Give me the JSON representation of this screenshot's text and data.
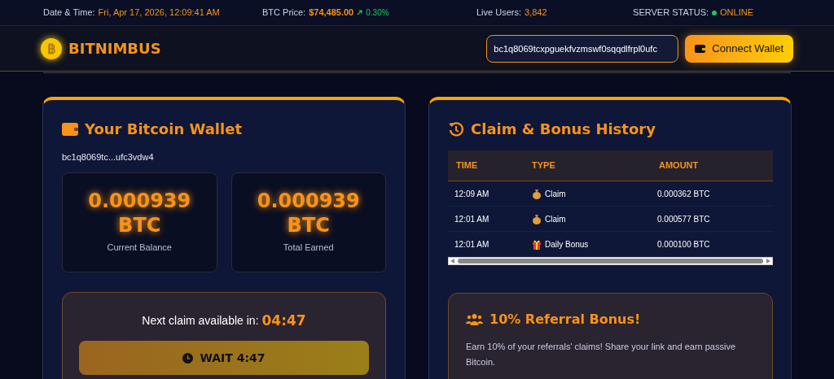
{
  "topbar": {
    "datetime": {
      "label": "Date & Time:",
      "value": "Fri, Apr 17, 2026, 12:09:41 AM"
    },
    "btc_price": {
      "label": "BTC Price:",
      "value": "$74,485.00",
      "change": "0.30%"
    },
    "live_users": {
      "label": "Live Users:",
      "value": "3,842"
    },
    "server_status": {
      "label": "SERVER STATUS:",
      "value": "ONLINE",
      "online": true
    }
  },
  "header": {
    "brand": "BITNIMBUS",
    "address_field": {
      "value": "bc1q8069tcxpguekfvzmswf0sqqdlfrpl0ufc"
    },
    "connect_button": "Connect Wallet"
  },
  "wallet_card": {
    "title": "Your Bitcoin Wallet",
    "address": "bc1q8069tc...ufc3vdw4",
    "stats": [
      {
        "value": "0.000939",
        "unit": "BTC",
        "label": "Current Balance"
      },
      {
        "value": "0.000939",
        "unit": "BTC",
        "label": "Total Earned"
      }
    ],
    "claim": {
      "text": "Next claim available in:",
      "countdown": "04:47",
      "button": "WAIT 4:47",
      "disabled": true
    }
  },
  "history_card": {
    "title": "Claim & Bonus History",
    "columns": [
      "TIME",
      "TYPE",
      "AMOUNT"
    ],
    "rows": [
      {
        "time": "12:09 AM",
        "kind": "claim",
        "type": "Claim",
        "amount": "0.000362 BTC"
      },
      {
        "time": "12:01 AM",
        "kind": "claim",
        "type": "Claim",
        "amount": "0.000577 BTC"
      },
      {
        "time": "12:01 AM",
        "kind": "bonus",
        "type": "Daily Bonus",
        "amount": "0.000100 BTC"
      }
    ]
  },
  "referral": {
    "title": "10% Referral Bonus!",
    "text": "Earn 10% of your referrals' claims! Share your link and earn passive Bitcoin."
  }
}
